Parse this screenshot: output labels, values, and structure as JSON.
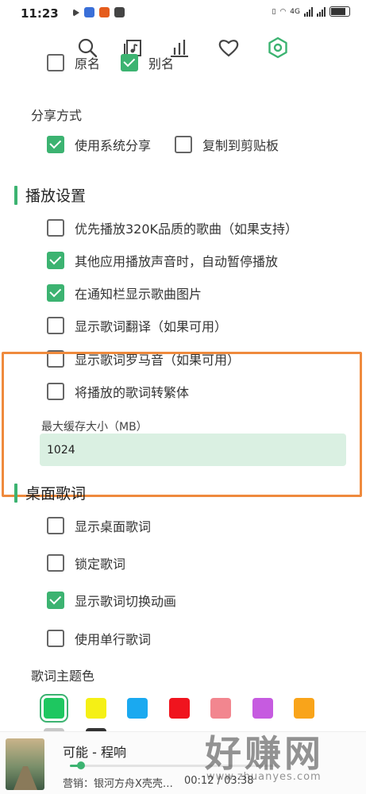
{
  "status_bar": {
    "time": "11:23",
    "network": "4G"
  },
  "nav": {
    "icons": [
      "search-icon",
      "playlist-music-icon",
      "chart-bars-icon",
      "heart-icon",
      "settings-hexagon-icon"
    ],
    "active": "settings-hexagon-icon"
  },
  "partial_row": {
    "original_label": "原名",
    "original_checked": false,
    "alias_label": "别名",
    "alias_checked": true
  },
  "share": {
    "title": "分享方式",
    "system_share": {
      "label": "使用系统分享",
      "checked": true
    },
    "clipboard": {
      "label": "复制到剪贴板",
      "checked": false
    }
  },
  "playback": {
    "title": "播放设置",
    "items": [
      {
        "label": "优先播放320K品质的歌曲（如果支持）",
        "checked": false
      },
      {
        "label": "其他应用播放声音时，自动暂停播放",
        "checked": true
      },
      {
        "label": "在通知栏显示歌曲图片",
        "checked": true
      },
      {
        "label": "显示歌词翻译（如果可用）",
        "checked": false
      },
      {
        "label": "显示歌词罗马音（如果可用）",
        "checked": false
      },
      {
        "label": "将播放的歌词转繁体",
        "checked": false
      }
    ],
    "cache_label": "最大缓存大小（MB）",
    "cache_value": "1024"
  },
  "desktop_lyrics": {
    "title": "桌面歌词",
    "items": [
      {
        "label": "显示桌面歌词",
        "checked": false
      },
      {
        "label": "锁定歌词",
        "checked": false
      },
      {
        "label": "显示歌词切换动画",
        "checked": true
      },
      {
        "label": "使用单行歌词",
        "checked": false
      }
    ],
    "theme_title": "歌词主题色",
    "colors": [
      "#1ec760",
      "#f5f015",
      "#1aa9f0",
      "#f0141e",
      "#f2868f",
      "#c65be0",
      "#f9a41a"
    ],
    "colors_row2": [
      "#c8c8c8",
      "#333333"
    ],
    "selected_color": "#1ec760"
  },
  "player": {
    "title": "可能 - 程响",
    "ad": "营销：银河方舟X壳壳…",
    "time": "00:12 / 03:38",
    "progress": 0.055
  },
  "watermark": {
    "big": "好赚网",
    "small": "www.zhuanyes.com"
  }
}
